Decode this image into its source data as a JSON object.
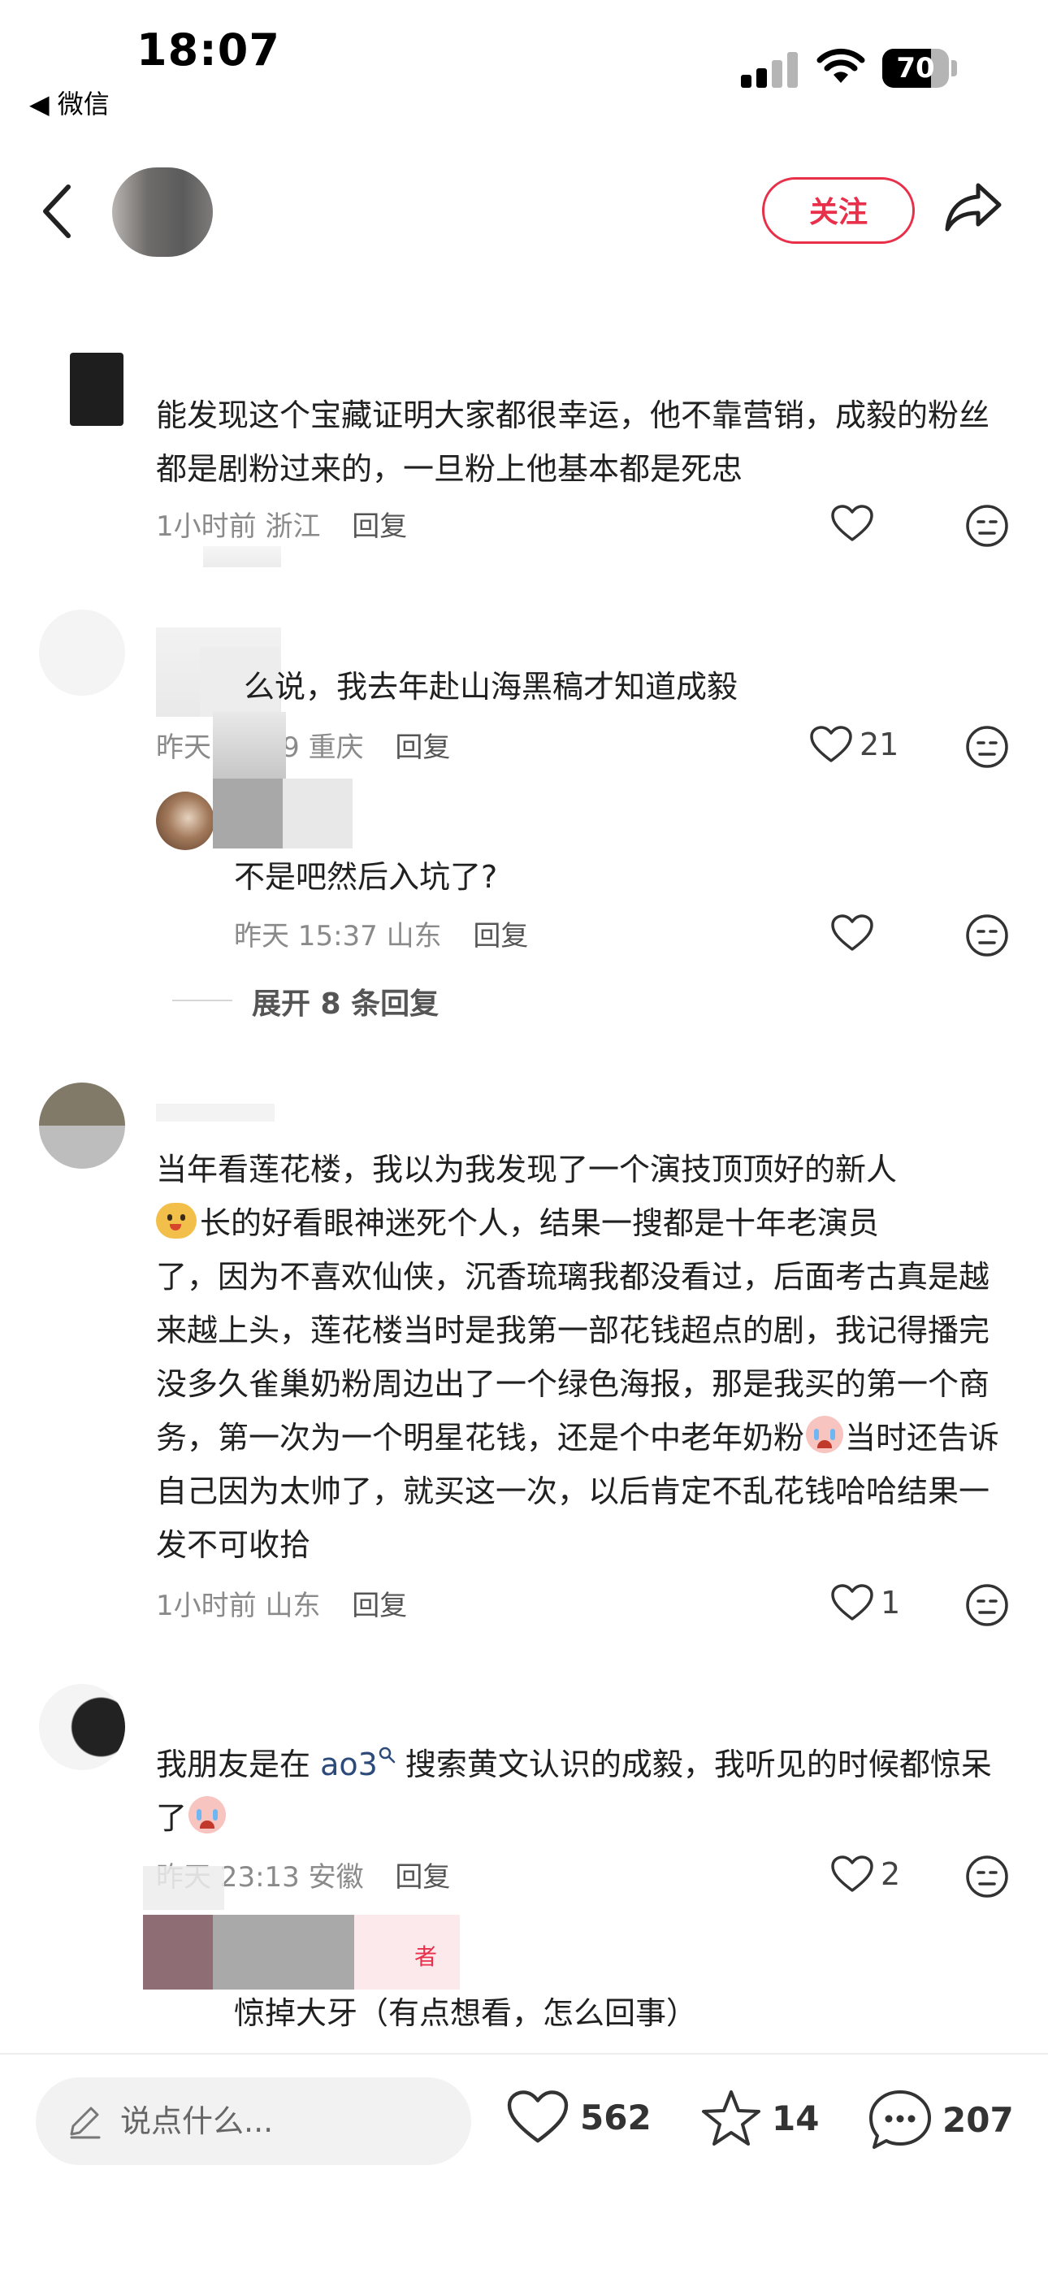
{
  "status_bar": {
    "time": "18:07",
    "back_app": "◀ 微信",
    "battery": "70"
  },
  "header": {
    "follow_label": "关注"
  },
  "comments": [
    {
      "text": "能发现这个宝藏证明大家都很幸运，他不靠营销，成毅的粉丝都是剧粉过来的，一旦粉上他基本都是死忠",
      "time": "1小时前",
      "location": "浙江",
      "reply": "回复"
    },
    {
      "text": "么说，我去年赴山海黑稿才知道成毅",
      "time": "昨天 15:09",
      "location": "重庆",
      "reply": "回复",
      "likes": "21",
      "sub_reply": {
        "text": "不是吧然后入坑了?",
        "time": "昨天 15:37",
        "location": "山东",
        "reply": "回复"
      },
      "expand": "展开 8 条回复"
    },
    {
      "text_1": "当年看莲花楼，我以为我发现了一个演技顶顶好的新人",
      "text_2": "长的好看眼神迷死个人，结果一搜都是十年老演员",
      "text_3": "了，因为不喜欢仙侠，沉香琉璃我都没看过，后面考古真是越来越上头，莲花楼当时是我第一部花钱超点的剧，我记得播完没多久雀巢奶粉周边出了一个绿色海报，那是我买的第一个商务，第一次为一个明星花钱，还是个中老年",
      "text_4": "奶粉",
      "text_5": "当时还告诉自己因为太帅了，就买这一次，以后肯定不乱花钱哈哈结果一发不可收拾",
      "time": "1小时前",
      "location": "山东",
      "reply": "回复",
      "likes": "1"
    },
    {
      "text_1": "我朋友是在 ",
      "link": "ao3",
      "text_2": " 搜索黄文认识的成毅，我听见的时候都惊呆了",
      "time": "昨天 23:13",
      "location": "安徽",
      "reply": "回复",
      "likes": "2",
      "badge": "者",
      "sub_reply": {
        "text": "惊掉大牙（有点想看，怎么回事）"
      }
    }
  ],
  "bottom_bar": {
    "input_placeholder": "说点什么...",
    "likes": "562",
    "stars": "14",
    "comments": "207"
  },
  "colors": {
    "accent": "#e8304a",
    "link": "#2d4b7a"
  }
}
